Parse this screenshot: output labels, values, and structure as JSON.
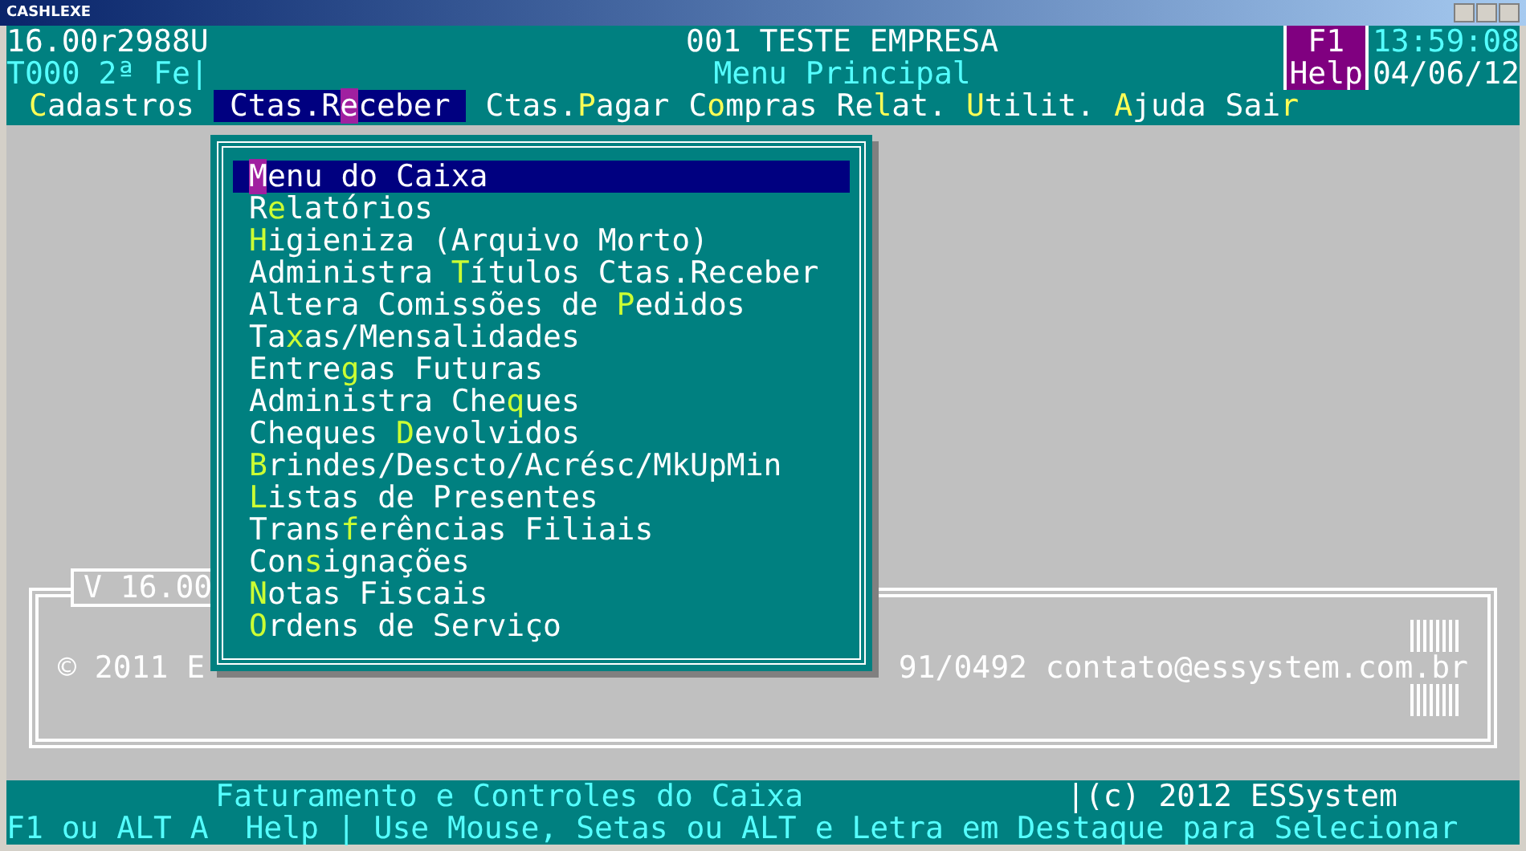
{
  "window": {
    "title": "CASHLEXE"
  },
  "header": {
    "version": "16.00r2988U",
    "company": "001 TESTE EMPRESA",
    "help_key": "F1",
    "help_label": "Help",
    "time": "13:59:08",
    "terminal": "T000 2ª Fe|",
    "screen_title": "Menu Principal",
    "date": "04/06/12"
  },
  "menu_bar": [
    {
      "label": "**C**adastros",
      "selected": false
    },
    {
      "label": "Ctas.R**e**ceber",
      "selected": true
    },
    {
      "label": "Ctas.**P**agar",
      "selected": false
    },
    {
      "label": "C**o**mpras",
      "selected": false
    },
    {
      "label": "Re**l**at.",
      "selected": false
    },
    {
      "label": "**U**tilit.",
      "selected": false
    },
    {
      "label": "**A**juda",
      "selected": false
    },
    {
      "label": "Sai**r**",
      "selected": false
    }
  ],
  "dropdown": [
    {
      "label": "**M**enu do Caixa",
      "selected": true
    },
    {
      "label": "R**e**latórios",
      "selected": false
    },
    {
      "label": "**H**igieniza (Arquivo Morto)",
      "selected": false
    },
    {
      "label": "Administra **T**ítulos Ctas.Receber",
      "selected": false
    },
    {
      "label": "Altera Comissões de **P**edidos",
      "selected": false
    },
    {
      "label": "Ta**x**as/Mensalidades",
      "selected": false
    },
    {
      "label": "Entre**g**as Futuras",
      "selected": false
    },
    {
      "label": "Administra Che**q**ues",
      "selected": false
    },
    {
      "label": "Cheques **D**evolvidos",
      "selected": false
    },
    {
      "label": "**B**rindes/Descto/Acrésc/MkUpMin",
      "selected": false
    },
    {
      "label": "**L**istas de Presentes",
      "selected": false
    },
    {
      "label": "Trans**f**erências Filiais",
      "selected": false
    },
    {
      "label": "Con**s**ignações",
      "selected": false
    },
    {
      "label": "**N**otas Fiscais",
      "selected": false
    },
    {
      "label": "**O**rdens de Serviço",
      "selected": false
    }
  ],
  "splash": {
    "version": "V 16.00",
    "copyright": "© 2011 E",
    "contact": "91/0492 contato@essystem.com.br"
  },
  "status_bar": {
    "description": "Faturamento e Controles do Caixa",
    "copyright": "|(c) 2012 ESSystem",
    "help": "F1 ou ALT A  Help | Use Mouse, Setas ou ALT e Letra em Destaque para Selecionar"
  }
}
